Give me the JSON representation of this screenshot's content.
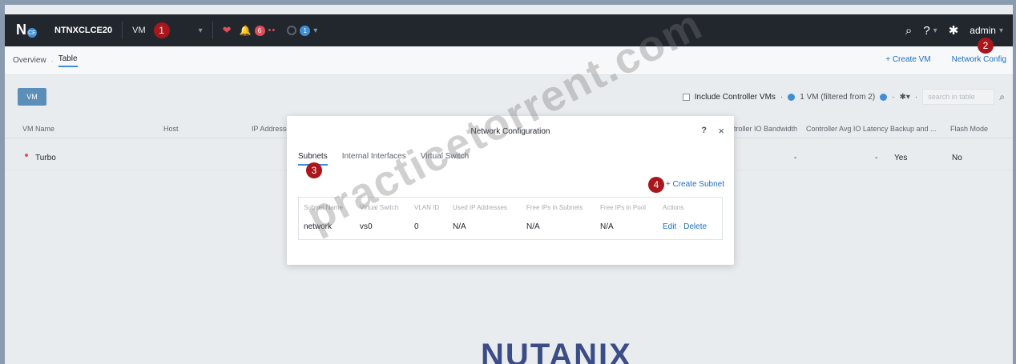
{
  "topbar": {
    "cluster_name": "NTNXCLCE20",
    "entity": "VM",
    "alert_count": "6",
    "task_count": "1",
    "user": "admin",
    "logo_badge": "CE",
    "help_glyph": "?",
    "dropdown_glyph": "▾"
  },
  "subnav": {
    "overview": "Overview",
    "table": "Table",
    "create_vm": "+ Create VM",
    "network_config": "Network Config"
  },
  "toolbar": {
    "vm_button": "VM",
    "include_controller": "Include Controller VMs",
    "vm_count": "1 VM (filtered from 2)",
    "search_placeholder": "search in table"
  },
  "table": {
    "columns": [
      "VM Name",
      "Host",
      "IP Addresse",
      "ntroller IO Bandwidth",
      "Controller Avg IO Latency",
      "Backup and ...",
      "Flash Mode"
    ],
    "rows": [
      {
        "name": "Turbo",
        "bandwidth": "-",
        "latency": "-",
        "backup": "Yes",
        "flash": "No"
      }
    ]
  },
  "modal": {
    "title": "Network Configuration",
    "help": "?",
    "close": "×",
    "tabs": [
      "Subnets",
      "Internal Interfaces",
      "Virtual Switch"
    ],
    "create_subnet": "+ Create Subnet",
    "columns": [
      "Subnet Name",
      "Virtual Switch",
      "VLAN ID",
      "Used IP Addresses",
      "Free IPs in Subnets",
      "Free IPs in Pool",
      "Actions"
    ],
    "row": {
      "name": "network",
      "vswitch": "vs0",
      "vlan": "0",
      "used": "N/A",
      "free_subnet": "N/A",
      "free_pool": "N/A",
      "edit": "Edit",
      "delete": "Delete"
    }
  },
  "markers": [
    "1",
    "2",
    "3",
    "4"
  ],
  "watermark": "practicetorrent.com",
  "brand": "NUTANIX",
  "colors": {
    "accent": "#3f8fd6",
    "topbar": "#22272e",
    "marker": "#a9161b",
    "alert": "#e34d59"
  }
}
